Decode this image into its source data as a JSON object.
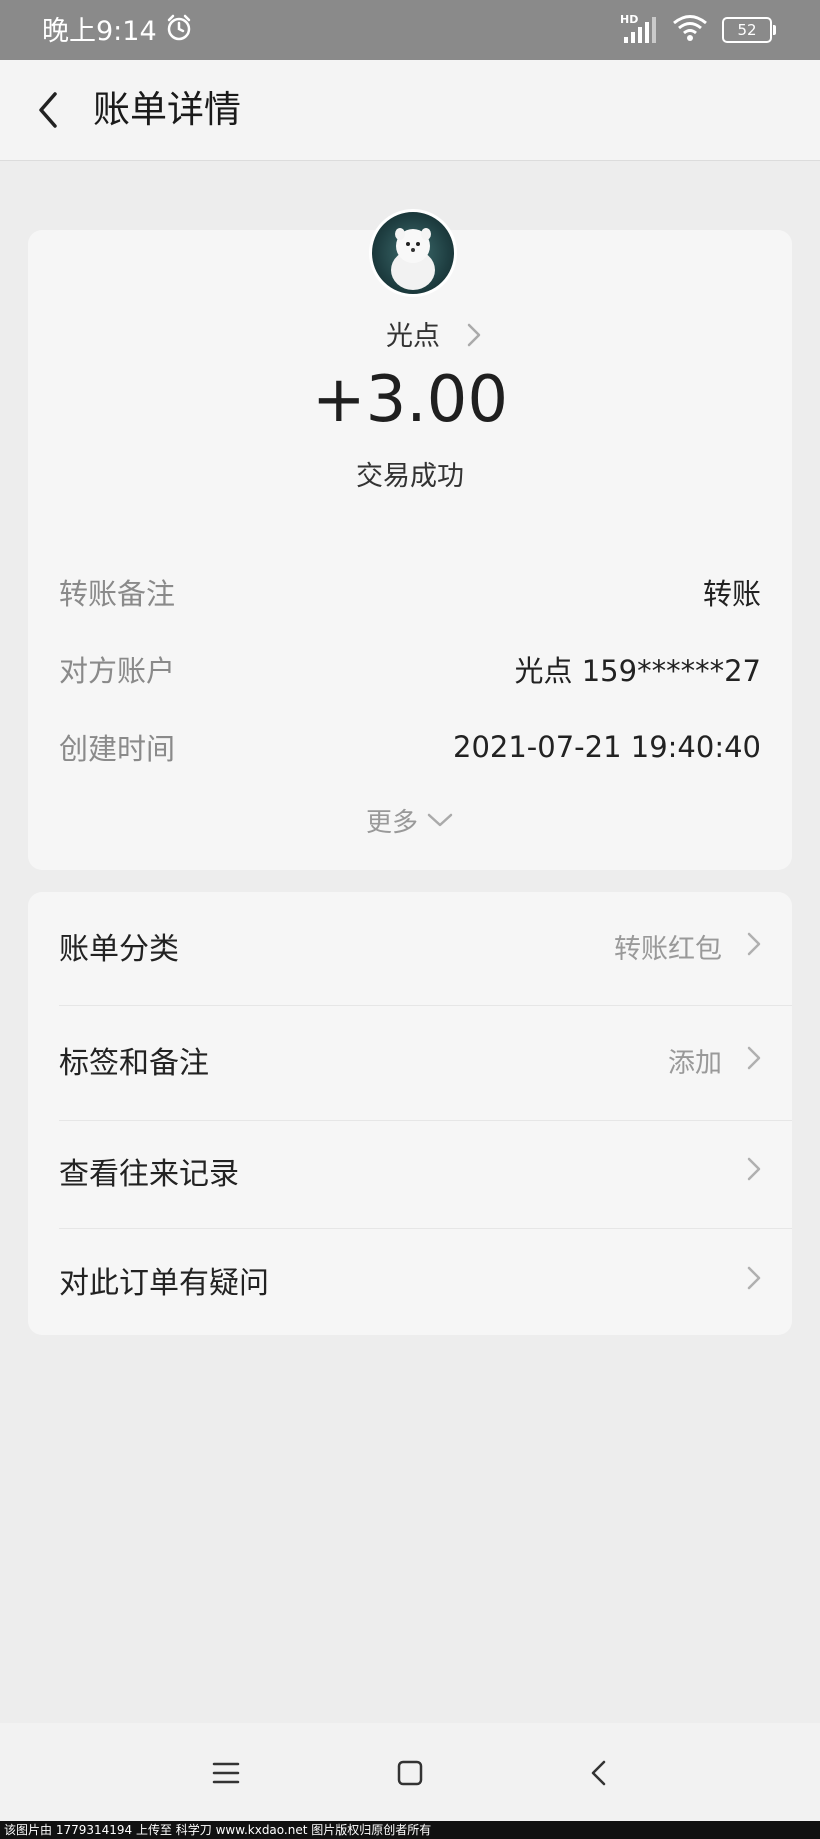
{
  "status_bar": {
    "time": "晚上9:14",
    "network": "HD",
    "battery": "52"
  },
  "header": {
    "title": "账单详情"
  },
  "summary": {
    "payee_name": "光点",
    "amount": "+3.00",
    "status": "交易成功",
    "details": [
      {
        "label": "转账备注",
        "value": "转账"
      },
      {
        "label": "对方账户",
        "value": "光点 159******27"
      },
      {
        "label": "创建时间",
        "value": "2021-07-21 19:40:40"
      }
    ],
    "more_label": "更多"
  },
  "menu": {
    "items": [
      {
        "label": "账单分类",
        "value": "转账红包"
      },
      {
        "label": "标签和备注",
        "value": "添加"
      },
      {
        "label": "查看往来记录",
        "value": ""
      },
      {
        "label": "对此订单有疑问",
        "value": ""
      }
    ]
  },
  "watermark": "该图片由 1779314194 上传至 科学刀 www.kxdao.net 图片版权归原创者所有"
}
